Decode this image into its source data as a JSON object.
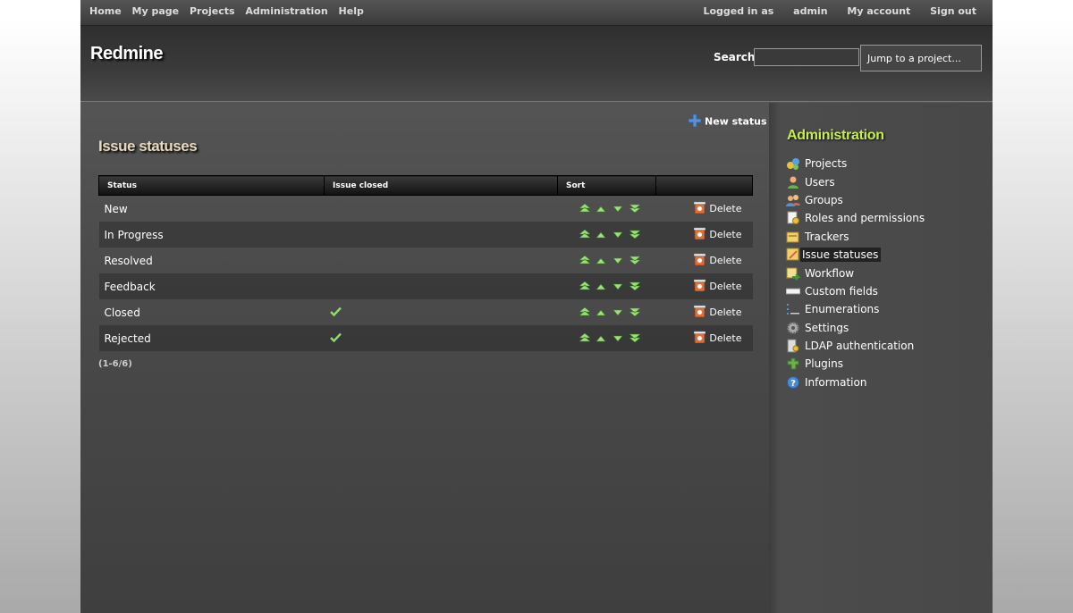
{
  "top_menu": {
    "items": [
      "Home",
      "My page",
      "Projects",
      "Administration",
      "Help"
    ],
    "logged_in": "Logged in as",
    "user": "admin",
    "my_account": "My account",
    "sign_out": "Sign out"
  },
  "header": {
    "app_title": "Redmine",
    "search_label": "Search:",
    "search_value": "",
    "jump_label": "Jump to a project..."
  },
  "content": {
    "new_status_label": "New status",
    "title": "Issue statuses",
    "columns": [
      "Status",
      "Issue closed",
      "Sort",
      ""
    ],
    "rows": [
      {
        "name": "New",
        "closed": false
      },
      {
        "name": "In Progress",
        "closed": false
      },
      {
        "name": "Resolved",
        "closed": false
      },
      {
        "name": "Feedback",
        "closed": false
      },
      {
        "name": "Closed",
        "closed": true
      },
      {
        "name": "Rejected",
        "closed": true
      }
    ],
    "delete_label": "Delete",
    "pagination": "(1-6/6)"
  },
  "sidebar": {
    "title": "Administration",
    "items": [
      {
        "label": "Projects",
        "icon": "projects-icon"
      },
      {
        "label": "Users",
        "icon": "user-icon"
      },
      {
        "label": "Groups",
        "icon": "group-icon"
      },
      {
        "label": "Roles and permissions",
        "icon": "roles-icon"
      },
      {
        "label": "Trackers",
        "icon": "tracker-icon"
      },
      {
        "label": "Issue statuses",
        "icon": "issue-status-icon",
        "selected": true
      },
      {
        "label": "Workflow",
        "icon": "workflow-icon"
      },
      {
        "label": "Custom fields",
        "icon": "custom-fields-icon"
      },
      {
        "label": "Enumerations",
        "icon": "list-icon"
      },
      {
        "label": "Settings",
        "icon": "gear-icon"
      },
      {
        "label": "LDAP authentication",
        "icon": "server-key-icon"
      },
      {
        "label": "Plugins",
        "icon": "plugin-icon"
      },
      {
        "label": "Information",
        "icon": "help-icon"
      }
    ]
  },
  "colors": {
    "accent_green": "#c6ef4c",
    "title_beige": "#e8d9bf",
    "check_green": "#8fdc6b"
  }
}
